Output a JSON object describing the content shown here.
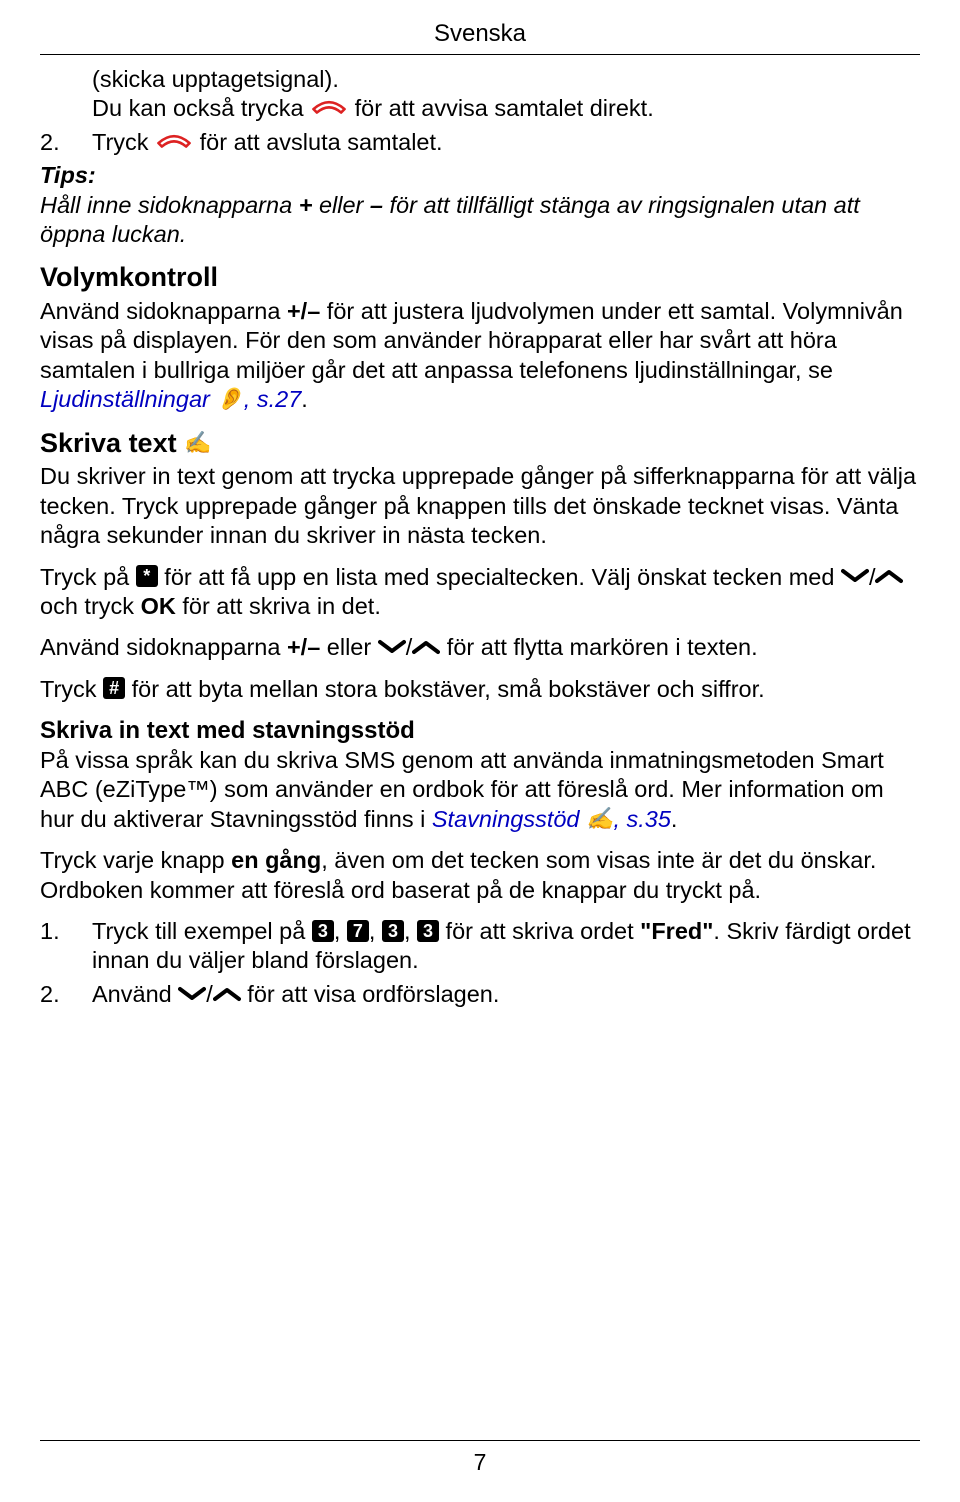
{
  "header": {
    "title": "Svenska"
  },
  "page_number": "7",
  "intro": {
    "line1": "(skicka upptagetsignal).",
    "line2a": "Du kan också trycka ",
    "line2b": " för att avvisa samtalet direkt.",
    "step2_num": "2.",
    "step2a": "Tryck ",
    "step2b": " för att avsluta samtalet."
  },
  "tips": {
    "label": "Tips:",
    "body_a": "Håll inne sidoknapparna ",
    "plus": "+",
    "body_b": " eller ",
    "minus": "–",
    "body_c": " för att tillfälligt stänga av ringsignalen utan att öppna luckan."
  },
  "volym": {
    "heading": "Volymkontroll",
    "p1a": "Använd sidoknapparna ",
    "pm": "+/–",
    "p1b": " för att justera ljudvolymen under ett samtal. Volymnivån visas på displayen. För den som använder hörapparat eller har svårt att höra samtalen i bullriga miljöer går det att anpassa telefonens ljudinställningar, se ",
    "link": "Ljudinställningar",
    "p1c": ", s.27"
  },
  "skriva": {
    "heading": "Skriva text",
    "p1": "Du skriver in text genom att trycka upprepade gånger på sifferknapparna för att välja tecken. Tryck upprepade gånger på knappen tills det önskade tecknet visas. Vänta några sekunder innan du skriver in nästa tecken.",
    "p2a": "Tryck på ",
    "p2b": " för att få upp en lista med specialtecken. Välj önskat tecken med ",
    "p2c": " och tryck ",
    "ok": "OK",
    "p2d": " för att skriva in det.",
    "p3a": "Använd sidoknapparna ",
    "pm": "+/–",
    "p3b": " eller ",
    "p3c": " för att flytta markören i texten.",
    "p4a": "Tryck ",
    "p4b": " för att byta mellan stora bokstäver, små bokstäver och siffror.",
    "star": "*",
    "hash": "#",
    "slash": "/"
  },
  "stavning": {
    "heading": "Skriva in text med stavningsstöd",
    "p1a": "På vissa språk kan du skriva SMS genom att använda inmatningsmetoden Smart ABC (eZiType™) som använder en ordbok för att föreslå ord. Mer information om hur du aktiverar Stavningsstöd finns i ",
    "link": "Stavningsstöd",
    "p1b": ", s.35",
    "p2a": "Tryck varje knapp ",
    "once": "en gång",
    "p2b": ", även om det tecken som visas inte är det du önskar. Ordboken kommer att föreslå ord baserat på de knappar du tryckt på.",
    "ol1_num": "1.",
    "ol1a": "Tryck till exempel på ",
    "k3": "3",
    "k7": "7",
    "sep": ", ",
    "ol1b": " för att skriva ordet ",
    "word": "\"Fred\"",
    "ol1c": ". Skriv färdigt ordet innan du väljer bland förslagen.",
    "ol2_num": "2.",
    "ol2a": "Använd ",
    "ol2b": " för att visa ordförslagen."
  }
}
